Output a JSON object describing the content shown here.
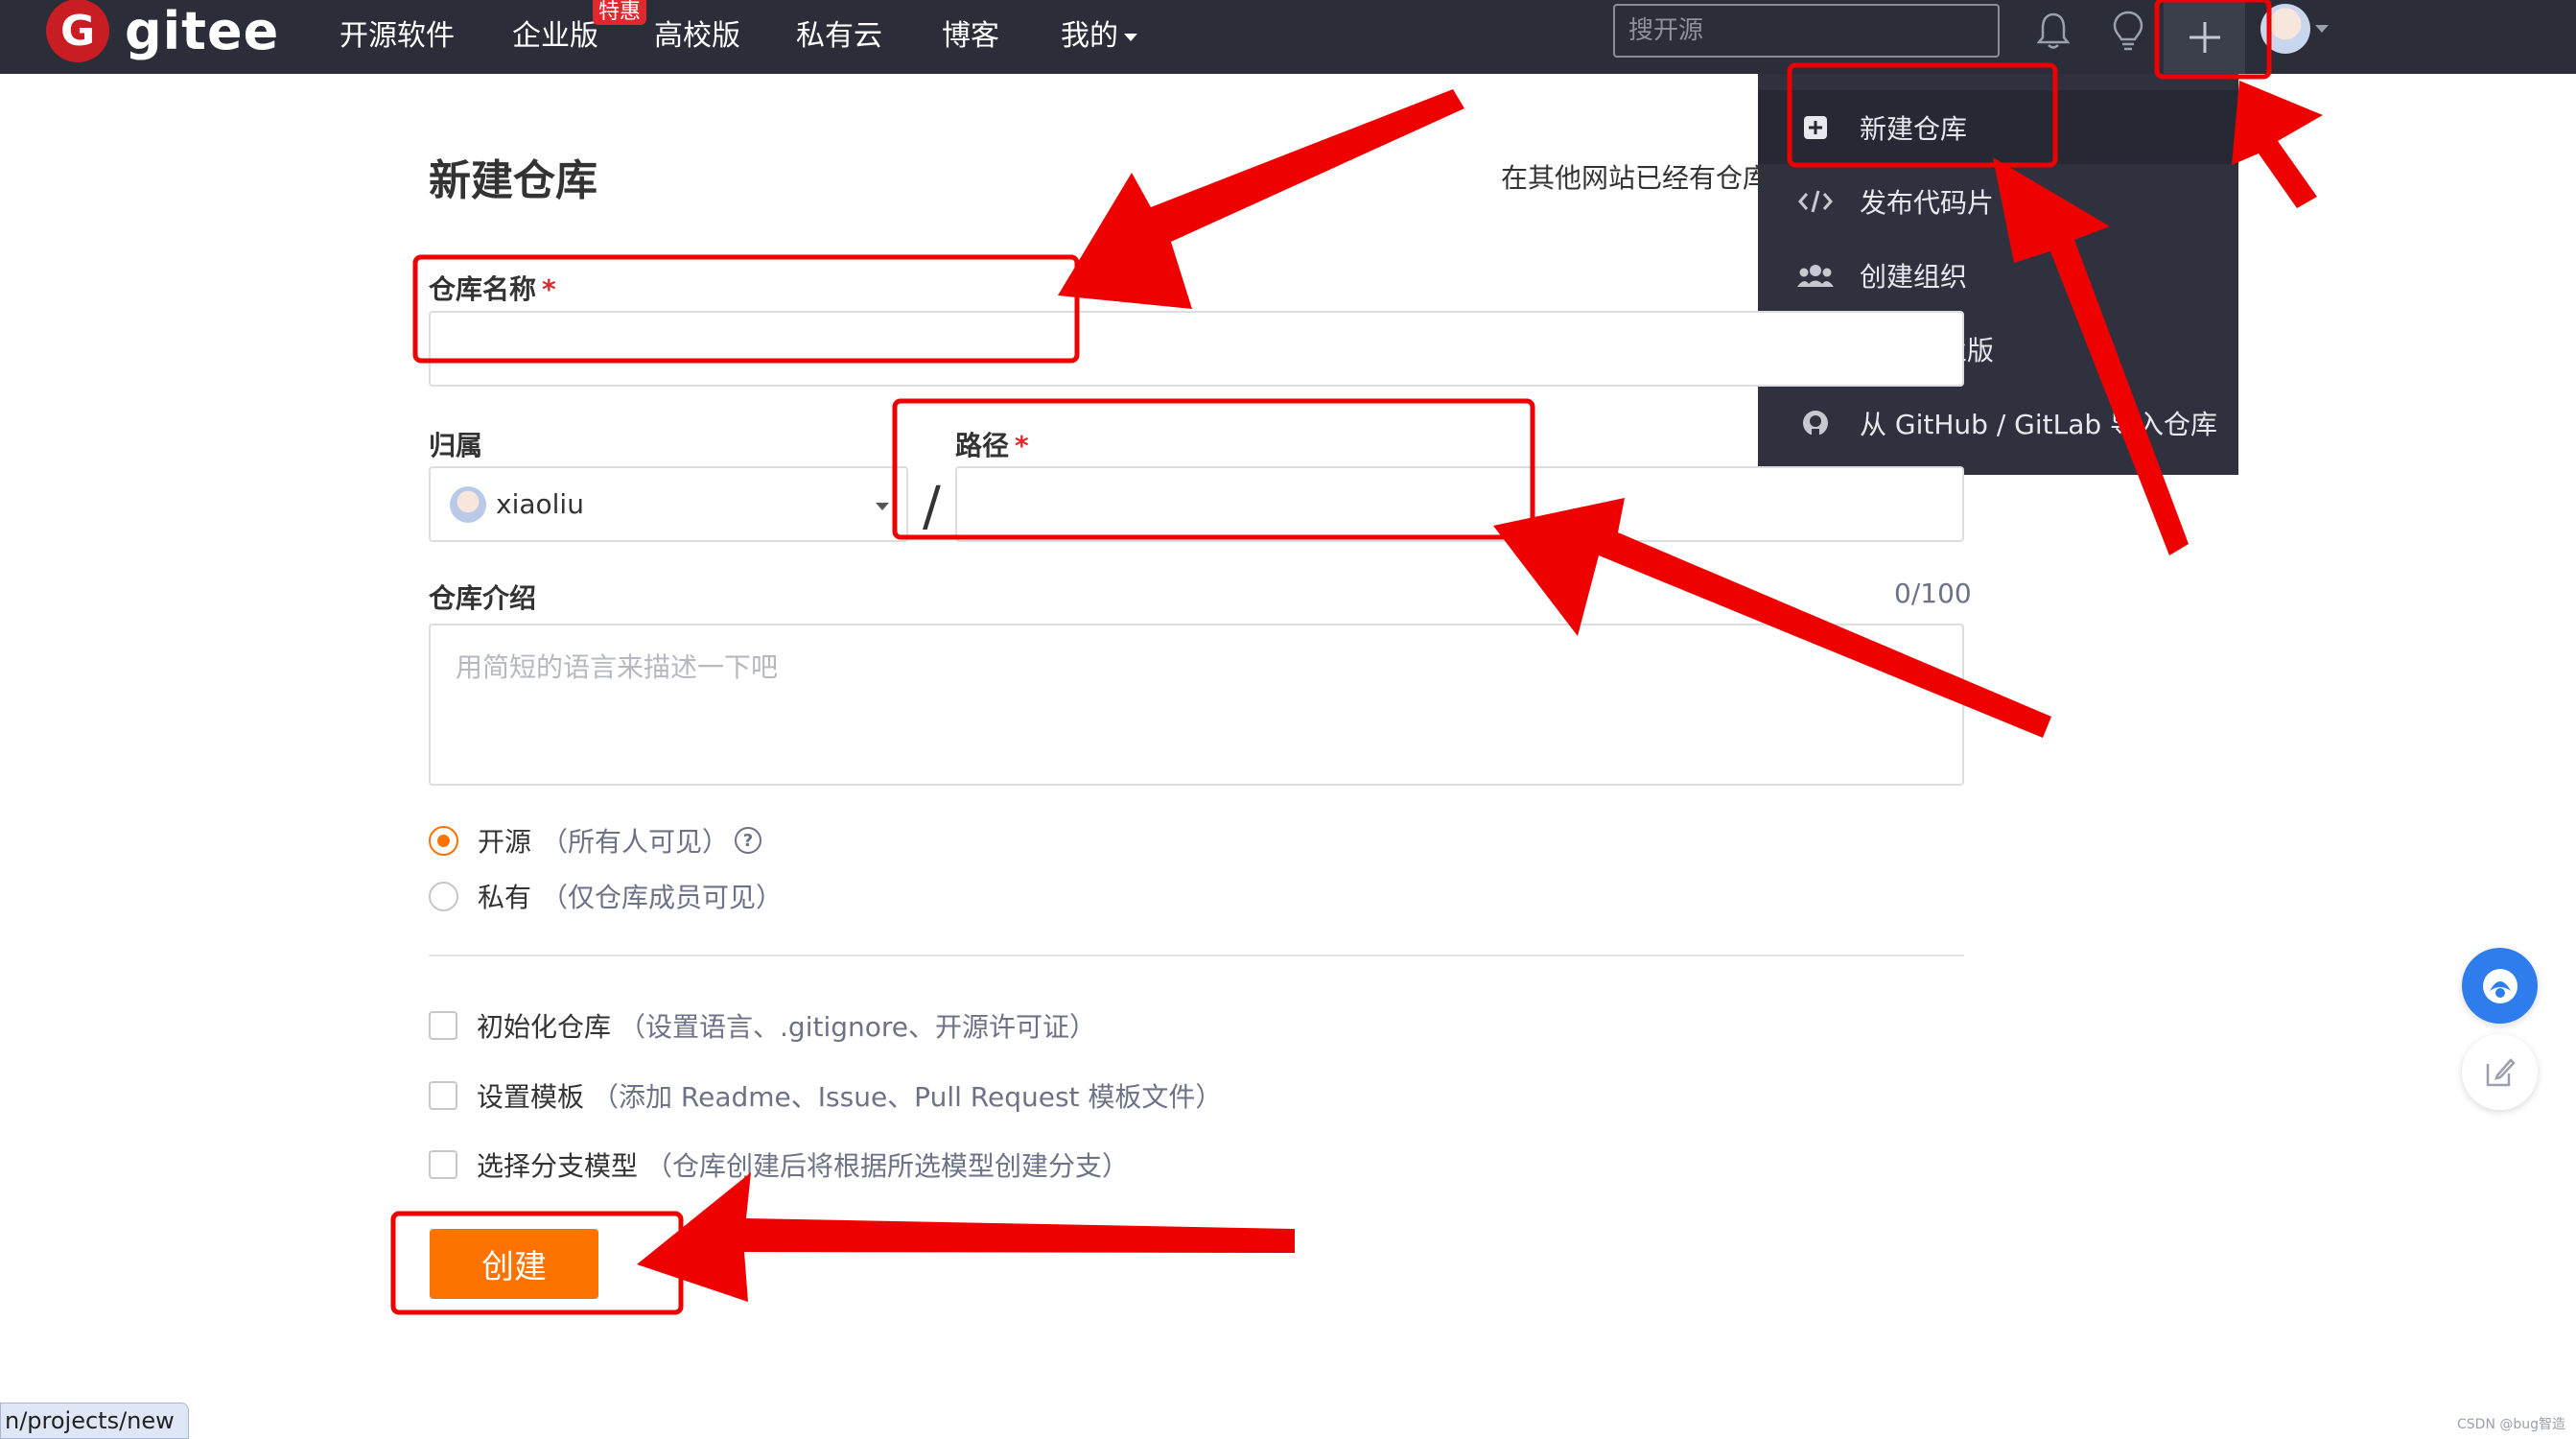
{
  "header": {
    "logo_letter": "G",
    "logo_text": "gitee",
    "nav": [
      "开源软件",
      "企业版",
      "高校版",
      "私有云",
      "博客"
    ],
    "nav_mine": "我的",
    "enterprise_badge": "特惠",
    "search_placeholder": "搜开源",
    "icons": [
      "bell-icon",
      "lightbulb-icon",
      "plus-icon",
      "avatar"
    ]
  },
  "dropdown": {
    "items": [
      {
        "label": "新建仓库",
        "icon": "plus-square-icon"
      },
      {
        "label": "发布代码片",
        "icon": "code-icon"
      },
      {
        "label": "创建组织",
        "icon": "users-icon"
      },
      {
        "label": "开通企业版",
        "icon": "building-icon"
      },
      {
        "label": "从 GitHub / GitLab 导入仓库",
        "icon": "github-icon"
      }
    ]
  },
  "form": {
    "title": "新建仓库",
    "import_hint": "在其他网站已经有仓库",
    "repo_name_label": "仓库名称",
    "required_mark": "*",
    "owner_label": "归属",
    "owner_value": "xiaoliu",
    "path_label": "路径",
    "path_separator": "/",
    "intro_label": "仓库介绍",
    "intro_counter": "0/100",
    "intro_placeholder": "用简短的语言来描述一下吧",
    "visibility": [
      {
        "label": "开源",
        "hint": "（所有人可见）",
        "selected": true
      },
      {
        "label": "私有",
        "hint": "（仅仓库成员可见）",
        "selected": false
      }
    ],
    "options": [
      {
        "label": "初始化仓库",
        "hint": "（设置语言、.gitignore、开源许可证）",
        "checked": false
      },
      {
        "label": "设置模板",
        "hint": "（添加 Readme、Issue、Pull Request 模板文件）",
        "checked": false
      },
      {
        "label": "选择分支模型",
        "hint": "（仓库创建后将根据所选模型创建分支）",
        "checked": false
      }
    ],
    "submit_label": "创建"
  },
  "status_bar": {
    "url": "n/projects/new"
  },
  "watermark": "CSDN @bug智造",
  "colors": {
    "accent": "#fe7300",
    "nav_bg": "#2b2d38",
    "dropdown_bg": "#2f323e",
    "annotation": "#ee0000"
  }
}
